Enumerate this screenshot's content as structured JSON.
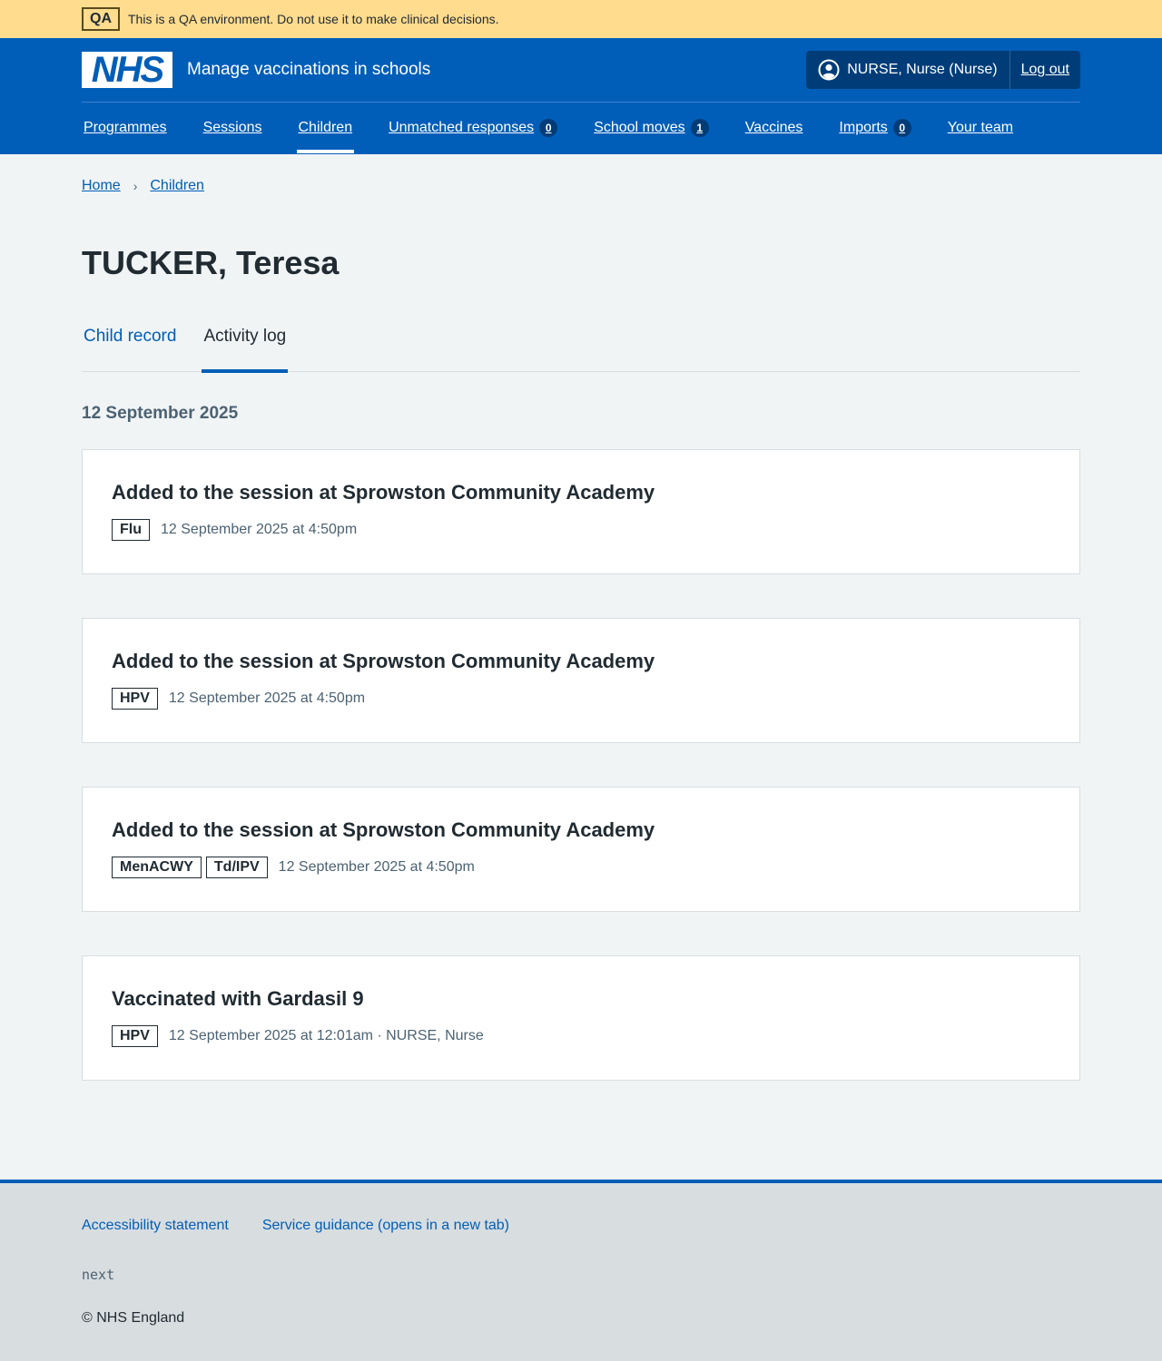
{
  "env_banner": {
    "tag": "QA",
    "text": "This is a QA environment. Do not use it to make clinical decisions."
  },
  "header": {
    "logo_text": "NHS",
    "service_name": "Manage vaccinations in schools",
    "user": "NURSE, Nurse (Nurse)",
    "logout": "Log out"
  },
  "nav": [
    {
      "label": "Programmes",
      "badge": null
    },
    {
      "label": "Sessions",
      "badge": null
    },
    {
      "label": "Children",
      "badge": null,
      "active": true
    },
    {
      "label": "Unmatched responses",
      "badge": "0"
    },
    {
      "label": "School moves",
      "badge": "1"
    },
    {
      "label": "Vaccines",
      "badge": null
    },
    {
      "label": "Imports",
      "badge": "0"
    },
    {
      "label": "Your team",
      "badge": null
    }
  ],
  "breadcrumb": {
    "home": "Home",
    "children": "Children"
  },
  "page_title": "TUCKER, Teresa",
  "tabs": {
    "child_record": "Child record",
    "activity_log": "Activity log"
  },
  "date_heading": "12 September 2025",
  "events": [
    {
      "title": "Added to the session at Sprowston Community Academy",
      "tags": [
        "Flu"
      ],
      "meta": "12 September 2025 at 4:50pm"
    },
    {
      "title": "Added to the session at Sprowston Community Academy",
      "tags": [
        "HPV"
      ],
      "meta": "12 September 2025 at 4:50pm"
    },
    {
      "title": "Added to the session at Sprowston Community Academy",
      "tags": [
        "MenACWY",
        "Td/IPV"
      ],
      "meta": "12 September 2025 at 4:50pm"
    },
    {
      "title": "Vaccinated with Gardasil 9",
      "tags": [
        "HPV"
      ],
      "meta": "12 September 2025 at 12:01am · NURSE, Nurse"
    }
  ],
  "footer": {
    "accessibility": "Accessibility statement",
    "guidance": "Service guidance (opens in a new tab)",
    "version": "next",
    "copyright": "© NHS England"
  },
  "colors": {
    "nhs_blue": "#005eb8",
    "banner_yellow": "#ffdc8e",
    "page_bg": "#f0f4f5"
  }
}
